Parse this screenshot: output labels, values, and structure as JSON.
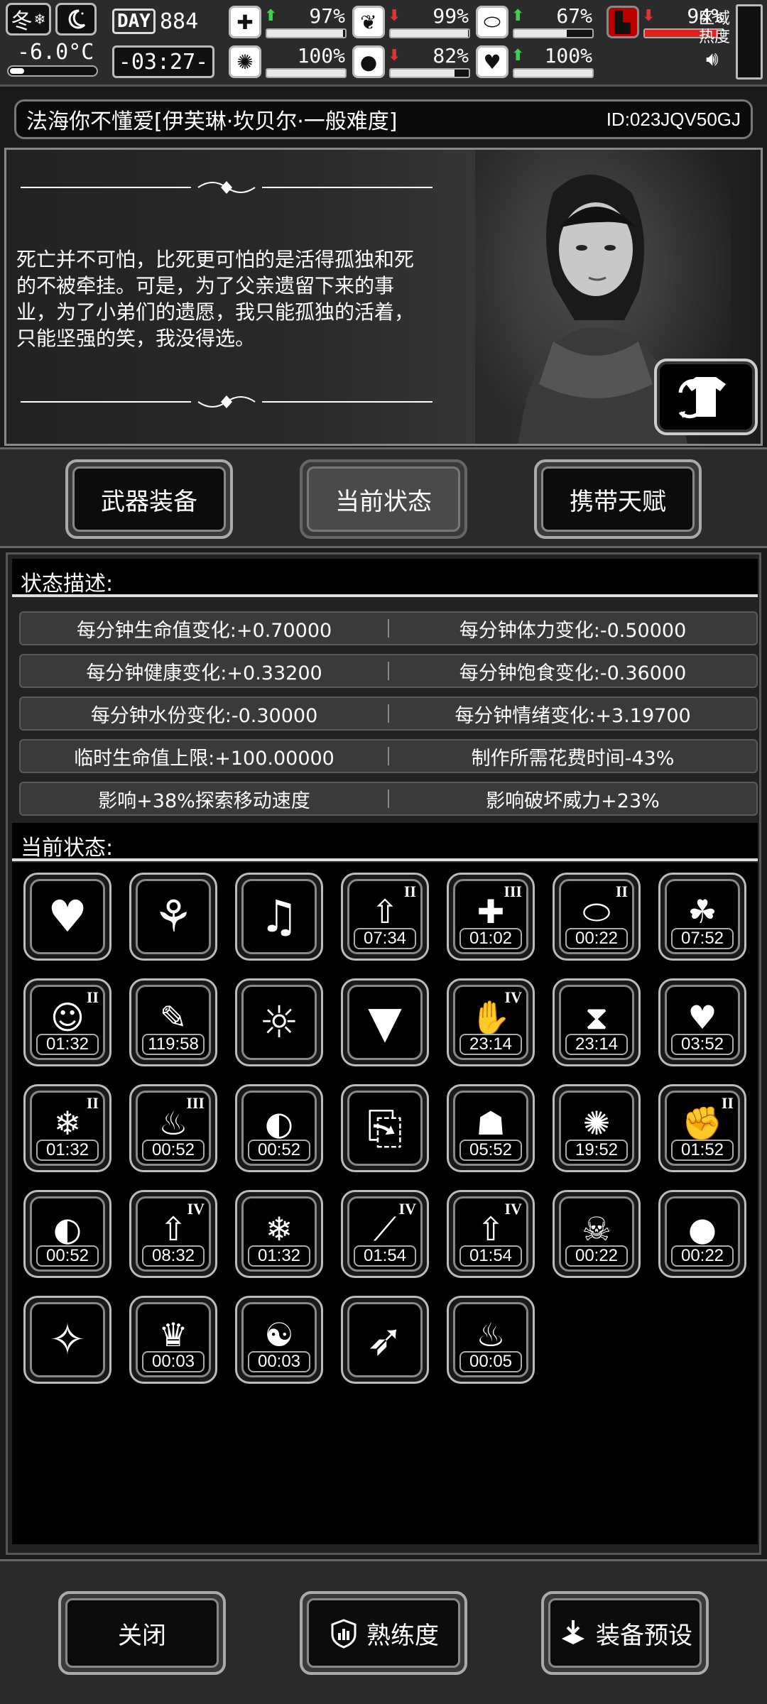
{
  "topbar": {
    "season": "冬",
    "temperature": "-6.0°C",
    "day_label": "DAY",
    "day_number": "884",
    "clock": "-03:27-",
    "stats": [
      {
        "id": "medical",
        "icon": "medkit-icon",
        "trend": "up",
        "value": "97%",
        "level": 0.97
      },
      {
        "id": "stomach",
        "icon": "stomach-icon",
        "trend": "down",
        "value": "99%",
        "level": 0.99
      },
      {
        "id": "pill",
        "icon": "pill-icon",
        "trend": "up",
        "value": "67%",
        "level": 0.67
      },
      {
        "id": "brain",
        "icon": "brain-icon",
        "trend": "",
        "value": "100%",
        "level": 1.0
      },
      {
        "id": "water",
        "icon": "water-drop-icon",
        "trend": "down",
        "value": "82%",
        "level": 0.82
      },
      {
        "id": "heart",
        "icon": "heart-icon",
        "trend": "up",
        "value": "100%",
        "level": 1.0
      },
      {
        "id": "boot",
        "icon": "boot-icon",
        "trend": "down",
        "value": "94%",
        "level": 0.94
      }
    ],
    "zone_label": "区域热度"
  },
  "title": {
    "name": "法海你不懂爱[伊芙琳·坎贝尔·一般难度]",
    "id": "ID:023JQV50GJ"
  },
  "story": {
    "text": "死亡并不可怕，比死更可怕的是活得孤独和死的不被牵挂。可是，为了父亲遗留下来的事业，为了小弟们的遗愿，我只能孤独的活着，只能坚强的笑，我没得选。"
  },
  "tabs": [
    {
      "label": "武器装备",
      "active": false
    },
    {
      "label": "当前状态",
      "active": true
    },
    {
      "label": "携带天赋",
      "active": false
    }
  ],
  "status_desc": {
    "header": "状态描述:",
    "rows": [
      [
        "每分钟生命值变化:+0.70000",
        "每分钟体力变化:-0.50000"
      ],
      [
        "每分钟健康变化:+0.33200",
        "每分钟饱食变化:-0.36000"
      ],
      [
        "每分钟水份变化:-0.30000",
        "每分钟情绪变化:+3.19700"
      ],
      [
        "临时生命值上限:+100.00000",
        "制作所需花费时间-43%"
      ],
      [
        "影响+38%探索移动速度",
        "影响破坏威力+23%"
      ]
    ]
  },
  "current_status": {
    "header": "当前状态:",
    "icons": [
      {
        "name": "heart-status-icon",
        "glyph": "♥",
        "level": "",
        "timer": ""
      },
      {
        "name": "stomach-status-icon",
        "glyph": "⚘",
        "level": "",
        "timer": ""
      },
      {
        "name": "music-heart-icon",
        "glyph": "♫",
        "level": "",
        "timer": ""
      },
      {
        "name": "stat-boost-icon",
        "glyph": "⇧",
        "level": "II",
        "timer": "07:34"
      },
      {
        "name": "health-boost-icon",
        "glyph": "✚",
        "level": "III",
        "timer": "01:02"
      },
      {
        "name": "pill-boost-icon",
        "glyph": "⬭",
        "level": "II",
        "timer": "00:22"
      },
      {
        "name": "arrow-leaf-icon",
        "glyph": "☘",
        "level": "",
        "timer": "07:52"
      },
      {
        "name": "happy-face-icon",
        "glyph": "☺",
        "level": "II",
        "timer": "01:32"
      },
      {
        "name": "syringe-icon",
        "glyph": "✎",
        "level": "",
        "timer": "119:58"
      },
      {
        "name": "alarm-person-icon",
        "glyph": "☼",
        "level": "",
        "timer": ""
      },
      {
        "name": "shirt-icon",
        "glyph": "▼",
        "level": "",
        "timer": ""
      },
      {
        "name": "injured-arm-icon",
        "glyph": "✋",
        "level": "IV",
        "timer": "23:14"
      },
      {
        "name": "dna-icon",
        "glyph": "⧗",
        "level": "",
        "timer": "23:14"
      },
      {
        "name": "meal-heart-icon",
        "glyph": "♥",
        "level": "",
        "timer": "03:52"
      },
      {
        "name": "cold-food-icon",
        "glyph": "❄",
        "level": "II",
        "timer": "01:32"
      },
      {
        "name": "hot-steam-icon",
        "glyph": "♨",
        "level": "III",
        "timer": "00:52"
      },
      {
        "name": "food-bag-icon",
        "glyph": "◐",
        "level": "",
        "timer": "00:52"
      },
      {
        "name": "medical-record-icon",
        "glyph": "⎘",
        "level": "",
        "timer": ""
      },
      {
        "name": "sleep-person-icon",
        "glyph": "☗",
        "level": "",
        "timer": "05:52"
      },
      {
        "name": "brain-status-icon",
        "glyph": "✺",
        "level": "",
        "timer": "19:52"
      },
      {
        "name": "fist-icon",
        "glyph": "✊",
        "level": "II",
        "timer": "01:52"
      },
      {
        "name": "food-bag-2-icon",
        "glyph": "◐",
        "level": "",
        "timer": "00:52"
      },
      {
        "name": "bottle-boost-icon",
        "glyph": "⇧",
        "level": "IV",
        "timer": "08:32"
      },
      {
        "name": "cold-food-2-icon",
        "glyph": "❄",
        "level": "",
        "timer": "01:32"
      },
      {
        "name": "weapon-boost-icon",
        "glyph": "⟋",
        "level": "IV",
        "timer": "01:54"
      },
      {
        "name": "weapon-boost-2-icon",
        "glyph": "⇧",
        "level": "IV",
        "timer": "01:54"
      },
      {
        "name": "skull-icon",
        "glyph": "☠",
        "level": "",
        "timer": "00:22"
      },
      {
        "name": "falling-drop-icon",
        "glyph": "●",
        "level": "",
        "timer": "00:22"
      },
      {
        "name": "healing-aura-icon",
        "glyph": "✧",
        "level": "",
        "timer": ""
      },
      {
        "name": "crown-aura-icon",
        "glyph": "♛",
        "level": "",
        "timer": "00:03"
      },
      {
        "name": "yin-yang-icon",
        "glyph": "☯",
        "level": "",
        "timer": "00:03"
      },
      {
        "name": "winged-foot-icon",
        "glyph": "➶",
        "level": "",
        "timer": ""
      },
      {
        "name": "fire-spirit-icon",
        "glyph": "♨",
        "level": "",
        "timer": "00:05"
      }
    ]
  },
  "bottom": {
    "close": "关闭",
    "proficiency": "熟练度",
    "preset": "装备预设"
  }
}
